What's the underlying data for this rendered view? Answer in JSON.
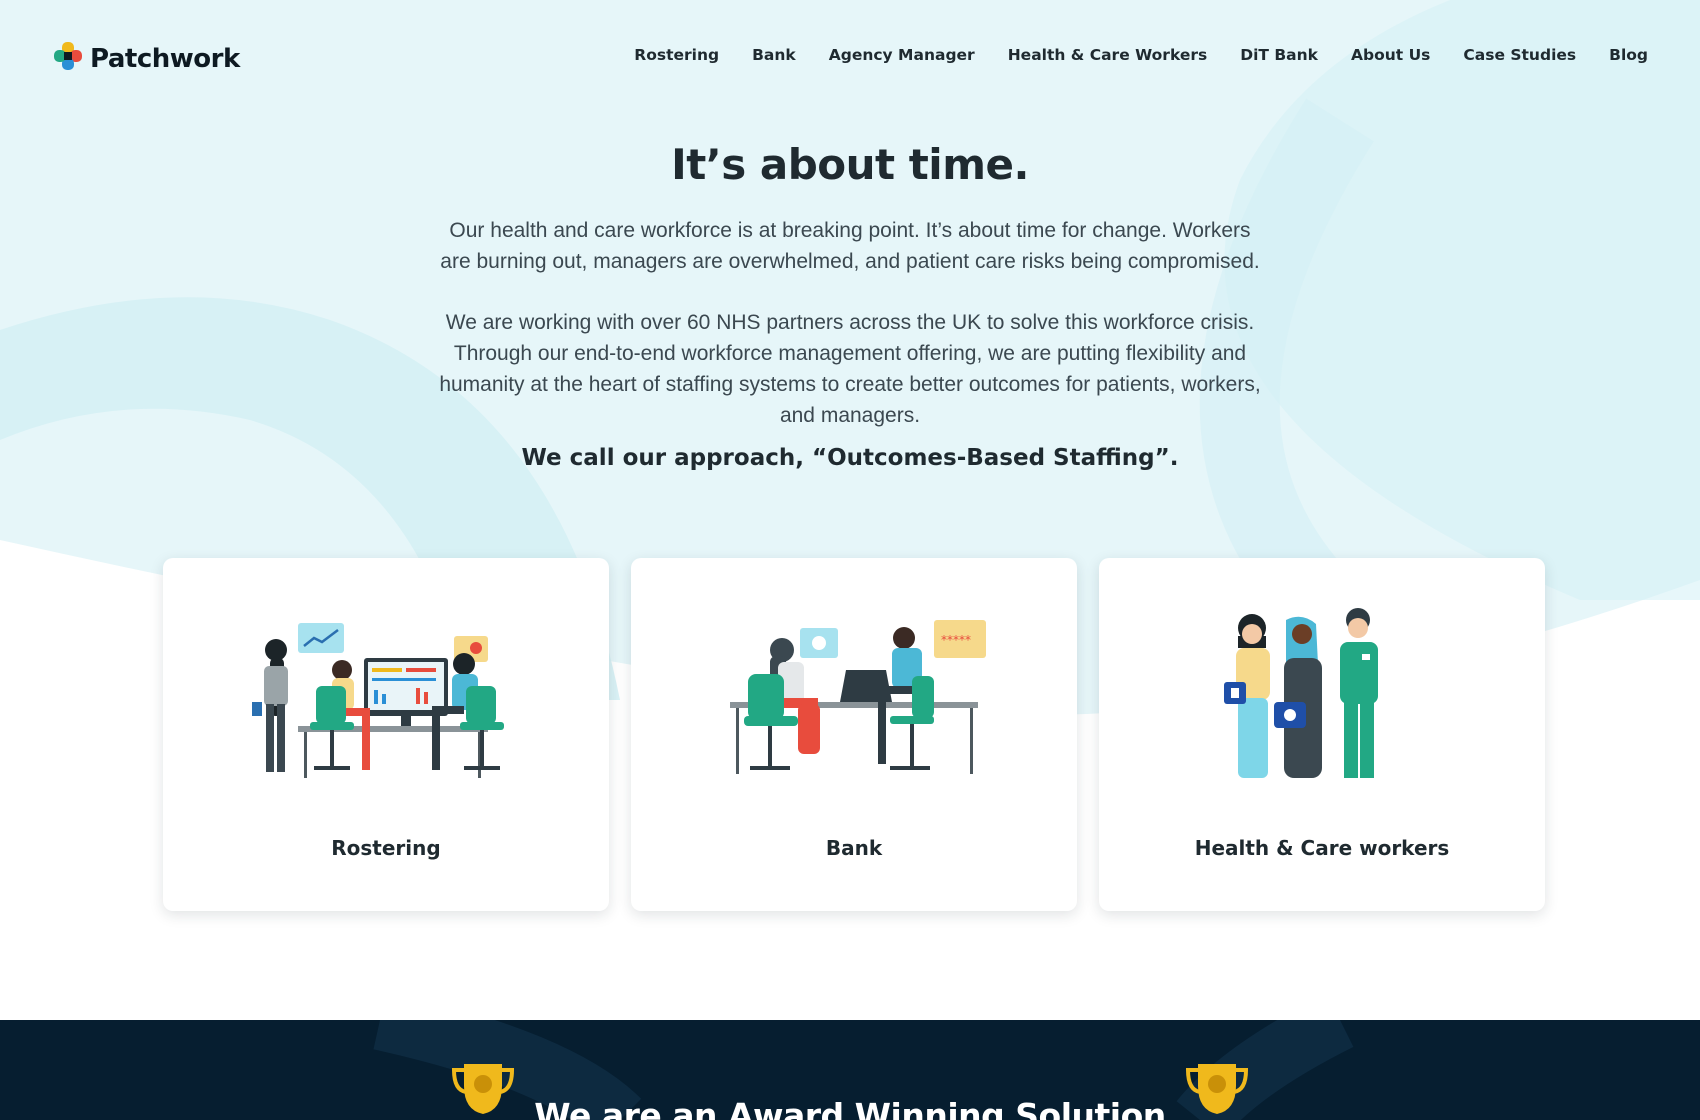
{
  "brand": {
    "name": "Patchwork"
  },
  "nav": {
    "items": [
      "Rostering",
      "Bank",
      "Agency Manager",
      "Health & Care Workers",
      "DiT Bank",
      "About Us",
      "Case Studies",
      "Blog"
    ]
  },
  "intro": {
    "title": "It’s about time.",
    "paragraph_1": "Our health and care workforce is at breaking point. It’s about time for change. Workers are burning out, managers are overwhelmed, and patient care risks being compromised.",
    "paragraph_2": "We are working with over 60 NHS partners across the UK to solve this workforce crisis. Through our end-to-end workforce management offering, we are putting flexibility and humanity at the heart of staffing systems to create better outcomes for patients, workers, and managers.",
    "approach": "We call our approach, “Outcomes-Based Staffing”."
  },
  "cards": [
    {
      "label": "Rostering",
      "icon": "rostering-illustration"
    },
    {
      "label": "Bank",
      "icon": "bank-illustration"
    },
    {
      "label": "Health & Care workers",
      "icon": "health-care-workers-illustration"
    }
  ],
  "award": {
    "title": "We are an Award Winning Solution",
    "icon": "trophy-icon"
  },
  "colors": {
    "hero_bg": "#e6f6f9",
    "hero_arc": "#d2eff4",
    "text_dark": "#1f2a30",
    "award_bg": "#061e30",
    "accent_teal": "#22a884",
    "accent_gold": "#f0b91c"
  }
}
